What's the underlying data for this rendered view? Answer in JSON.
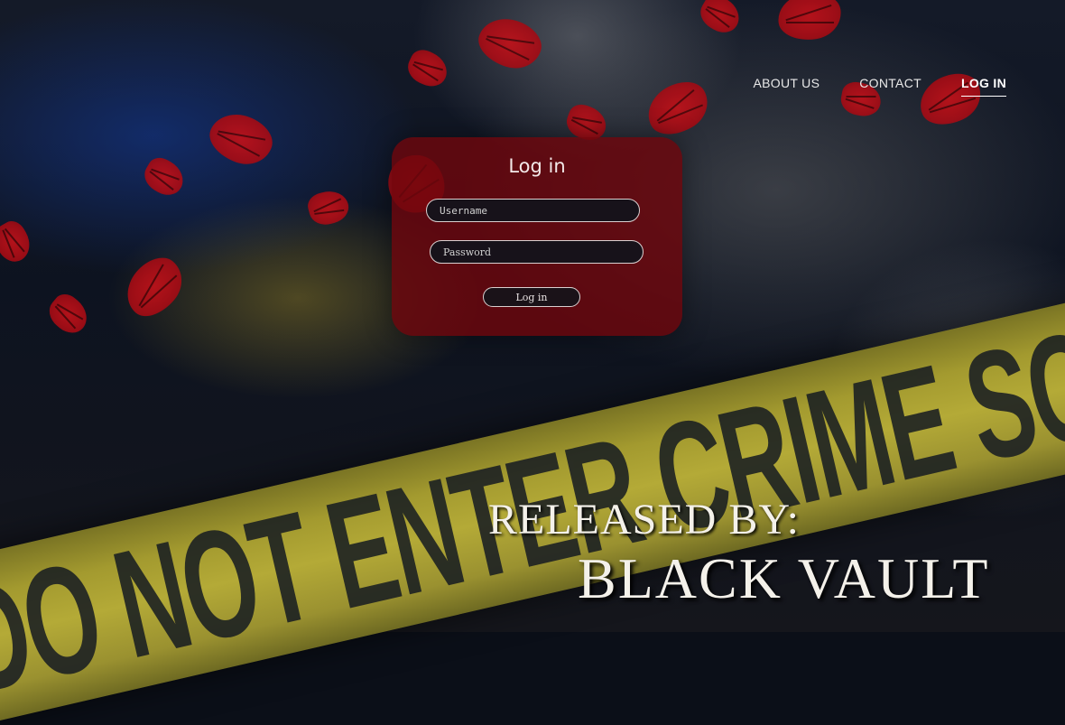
{
  "nav": {
    "about": "ABOUT US",
    "contact": "CONTACT",
    "login": "LOG IN"
  },
  "login_form": {
    "title": "Log in",
    "username_placeholder": "Username",
    "password_placeholder": "Password",
    "submit_label": "Log in"
  },
  "background": {
    "tape_text": "DO NOT ENTER  CRIME SCENE",
    "accent_color": "#c1121a",
    "tape_color": "#b4aa37"
  },
  "hero": {
    "released_by": "RELEASED BY:",
    "publisher": "BLACK VAULT"
  }
}
